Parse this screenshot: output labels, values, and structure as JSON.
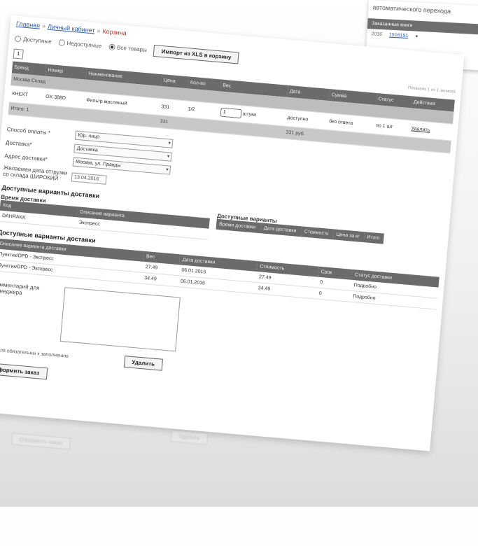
{
  "secondary": {
    "title": "автоматического перехода",
    "header": "Заказанные книги",
    "row": [
      "2016",
      "1516151",
      "●"
    ]
  },
  "breadcrumb": {
    "home": "Главная",
    "section": "Личный кабинет",
    "current": "Корзина"
  },
  "filters": {
    "available": "Доступные",
    "unavailable": "Недоступные",
    "all": "Все товары",
    "excel_button": "Импорт из XLS в корзину"
  },
  "pager": {
    "page": "1",
    "note": "Показано 1 из 1 записей"
  },
  "table": {
    "headers": [
      "Бренд",
      "Номер",
      "Наименование",
      "Цена",
      "Кол-во",
      "Вес",
      "Дата",
      "Сумма",
      "Статус",
      "Действия"
    ],
    "group_label": "Москва Склад",
    "row": {
      "brand": "КНЕХТ",
      "number": "OX 388D",
      "name": "Фильтр масляный",
      "price": "331",
      "qty_text": "1/2",
      "qty": "1",
      "unit": "штуки",
      "col1": "доступно",
      "col2": "без ответа",
      "col3": "по 1 шт",
      "action": "Удалить"
    },
    "total_label": "Итого: 1",
    "total_sum": "331",
    "total_word": "331 руб."
  },
  "form": {
    "payment_label": "Способ оплаты *",
    "payment_value": "Юр. лицо",
    "delivery_label": "Доставка*",
    "delivery_value": "Доставка",
    "address_label": "Адрес доставки*",
    "address_value": "Москва, ул. Правды",
    "date_label": "Желаемая дата отгрузки со склада ШИРОКИЙ",
    "date_value": "13.04.2016"
  },
  "delivery": {
    "title": "Доступные варианты доставки",
    "types_caption": "Время доставки",
    "types_headers": [
      "Код",
      "Описание варианта"
    ],
    "types_rows": [
      [
        "DAHRAKK",
        "Экспресс"
      ]
    ],
    "right_caption": "Доступные варианты",
    "right_headers": [
      "Время доставки",
      "Дата доставки",
      "Стоимость",
      "Цена за кг",
      "Итого"
    ]
  },
  "options": {
    "title": "Доступные варианты доставки",
    "headers": [
      "Описание варианта доставки",
      "Вес",
      "Дата доставки",
      "Стоимость",
      "Срок",
      "Статус доставки",
      ""
    ],
    "rows": [
      [
        "Пунктик/DPD - Экспресс",
        "27.49",
        "06.01.2016",
        "27.49",
        "0",
        "Подробно"
      ],
      [
        "Пунктик/DPD - Экспресс",
        "34.49",
        "06.01.2016",
        "34.49",
        "0",
        "Подробно"
      ]
    ]
  },
  "comment": {
    "label": "Комментарий для менеджера",
    "value": ""
  },
  "footer": {
    "note": "* - Поля обязательны к заполнению",
    "delete_button": "Удалить",
    "order_button": "Оформить заказ"
  }
}
